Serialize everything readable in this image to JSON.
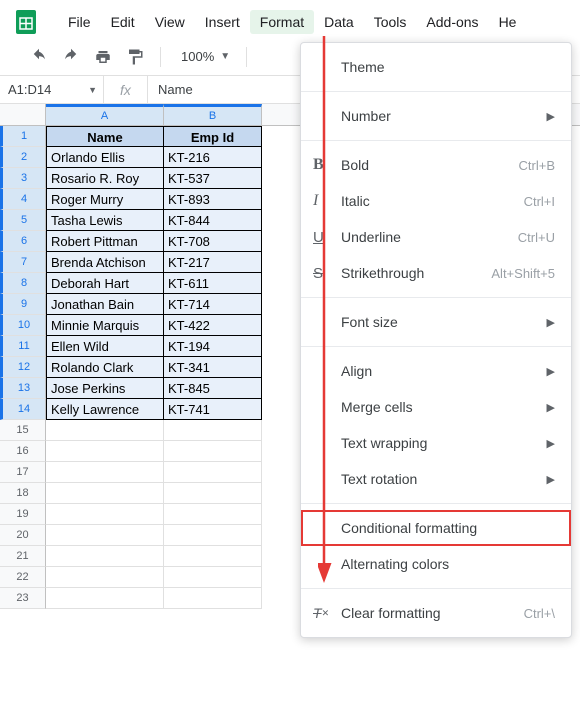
{
  "menubar": {
    "items": [
      "File",
      "Edit",
      "View",
      "Insert",
      "Format",
      "Data",
      "Tools",
      "Add-ons",
      "He"
    ],
    "active_index": 4
  },
  "toolbar": {
    "zoom": "100%"
  },
  "namebox": {
    "ref": "A1:D14",
    "fxlabel": "fx",
    "formula": "Name"
  },
  "columns": [
    "A",
    "B"
  ],
  "headers": {
    "A": "Name",
    "B": "Emp Id"
  },
  "data_rows": [
    {
      "n": 2,
      "A": "Orlando Ellis",
      "B": "KT-216"
    },
    {
      "n": 3,
      "A": "Rosario R. Roy",
      "B": "KT-537"
    },
    {
      "n": 4,
      "A": "Roger Murry",
      "B": "KT-893"
    },
    {
      "n": 5,
      "A": "Tasha Lewis",
      "B": "KT-844"
    },
    {
      "n": 6,
      "A": "Robert Pittman",
      "B": "KT-708"
    },
    {
      "n": 7,
      "A": "Brenda Atchison",
      "B": "KT-217"
    },
    {
      "n": 8,
      "A": "Deborah Hart",
      "B": "KT-611"
    },
    {
      "n": 9,
      "A": "Jonathan Bain",
      "B": "KT-714"
    },
    {
      "n": 10,
      "A": "Minnie Marquis",
      "B": "KT-422"
    },
    {
      "n": 11,
      "A": "Ellen Wild",
      "B": "KT-194"
    },
    {
      "n": 12,
      "A": "Rolando Clark",
      "B": "KT-341"
    },
    {
      "n": 13,
      "A": "Jose Perkins",
      "B": "KT-845"
    },
    {
      "n": 14,
      "A": "Kelly Lawrence",
      "B": "KT-741"
    }
  ],
  "empty_row_count_after": 9,
  "menu": {
    "theme": "Theme",
    "number": "Number",
    "bold": {
      "label": "Bold",
      "shortcut": "Ctrl+B"
    },
    "italic": {
      "label": "Italic",
      "shortcut": "Ctrl+I"
    },
    "underline": {
      "label": "Underline",
      "shortcut": "Ctrl+U"
    },
    "strike": {
      "label": "Strikethrough",
      "shortcut": "Alt+Shift+5"
    },
    "fontsize": "Font size",
    "align": "Align",
    "merge": "Merge cells",
    "wrap": "Text wrapping",
    "rotation": "Text rotation",
    "cond": "Conditional formatting",
    "alt": "Alternating colors",
    "clear": {
      "label": "Clear formatting",
      "shortcut": "Ctrl+\\"
    }
  }
}
